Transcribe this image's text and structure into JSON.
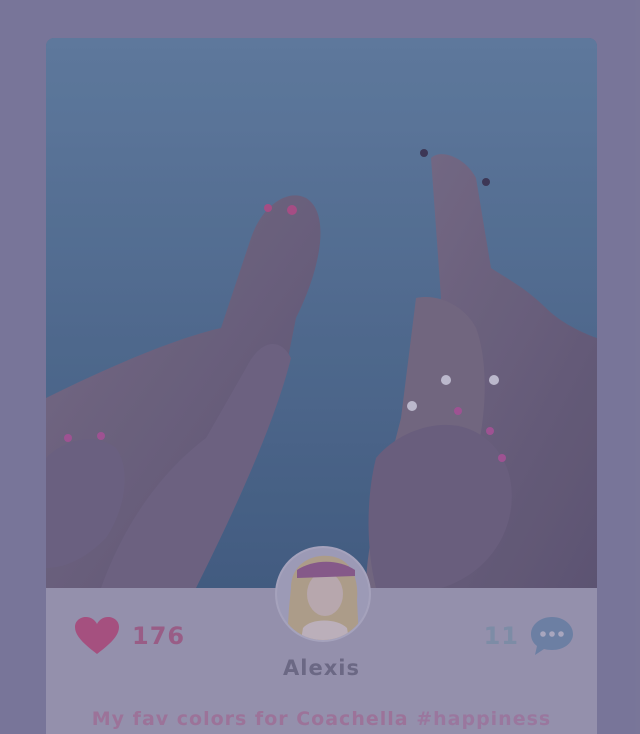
{
  "post": {
    "likes": "176",
    "comments": "11",
    "username": "Alexis",
    "caption_text": "My fav colors for Coachella ",
    "caption_hashtag": "#happiness"
  },
  "icons": {
    "like": "heart-icon",
    "comment": "chat-bubble-icon",
    "avatar": "user-avatar"
  },
  "colors": {
    "background": "#7d7a9c",
    "card": "#9c99b2",
    "heart": "#b0507f",
    "chat": "#6f86a8",
    "username": "#6e6b85",
    "caption": "#a5789c"
  }
}
